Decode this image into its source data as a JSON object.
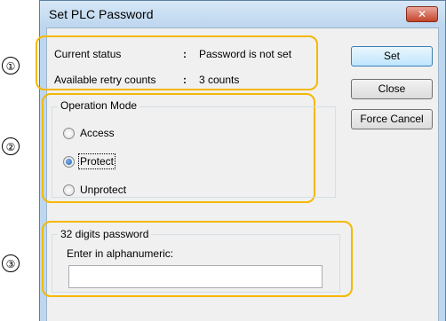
{
  "window": {
    "title": "Set PLC Password",
    "close_symbol": "✕"
  },
  "callouts": [
    "①",
    "②",
    "③"
  ],
  "status": {
    "current_label": "Current status",
    "current_sep": ":",
    "current_value": "Password is not set",
    "retry_label": "Available retry counts",
    "retry_sep": ":",
    "retry_value": "3 counts"
  },
  "operation_mode": {
    "title": "Operation Mode",
    "options": [
      "Access",
      "Protect",
      "Unprotect"
    ],
    "selected": "Protect"
  },
  "password": {
    "group_title": "32 digits password",
    "prompt": "Enter in alphanumeric:",
    "value": ""
  },
  "buttons": {
    "set": "Set",
    "close": "Close",
    "force_cancel": "Force Cancel"
  },
  "colors": {
    "highlight": "#f5b800",
    "window_frame": "#bcd7ef",
    "client_bg": "#f0f0f0"
  }
}
